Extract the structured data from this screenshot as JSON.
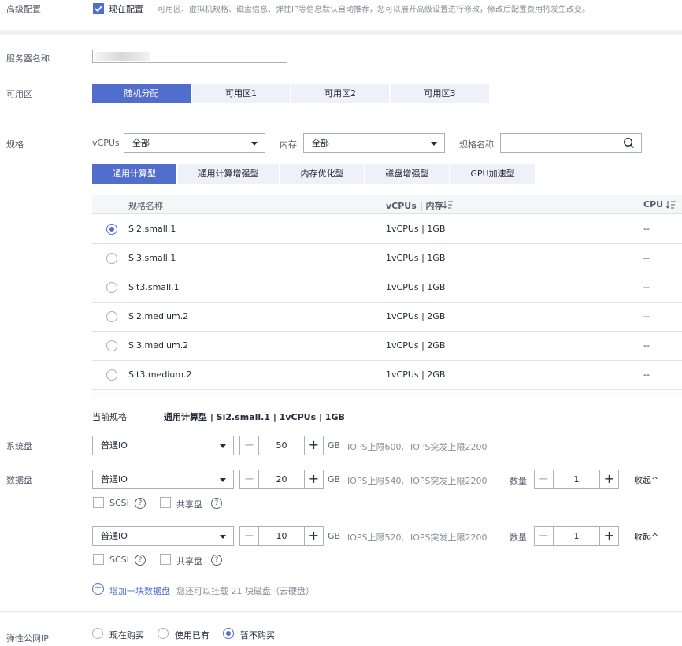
{
  "advanced": {
    "label": "高级配置",
    "checkbox_label": "现在配置",
    "hint": "可用区、虚拟机规格、磁盘信息、弹性IP等信息默认自动推荐，您可以展开高级设置进行修改，修改后配置费用将发生改变。"
  },
  "server_name": {
    "label": "服务器名称",
    "value": ""
  },
  "az": {
    "label": "可用区",
    "options": [
      "随机分配",
      "可用区1",
      "可用区2",
      "可用区3"
    ],
    "selected": 0
  },
  "spec": {
    "label": "规格",
    "vcpus_label": "vCPUs",
    "vcpus_value": "全部",
    "mem_label": "内存",
    "mem_value": "全部",
    "name_label": "规格名称",
    "name_placeholder": "",
    "tabs": [
      "通用计算型",
      "通用计算增强型",
      "内存优化型",
      "磁盘增强型",
      "GPU加速型"
    ],
    "active_tab": 0,
    "columns": [
      "规格名称",
      "vCPUs | 内存",
      "CPU"
    ],
    "sort_icon": "sort-icon",
    "rows": [
      {
        "name": "Si2.small.1",
        "spec": "1vCPUs | 1GB",
        "cpu": "--",
        "selected": true
      },
      {
        "name": "Si3.small.1",
        "spec": "1vCPUs | 1GB",
        "cpu": "--",
        "selected": false
      },
      {
        "name": "Sit3.small.1",
        "spec": "1vCPUs | 1GB",
        "cpu": "--",
        "selected": false
      },
      {
        "name": "Si2.medium.2",
        "spec": "1vCPUs | 2GB",
        "cpu": "--",
        "selected": false
      },
      {
        "name": "Si3.medium.2",
        "spec": "1vCPUs | 2GB",
        "cpu": "--",
        "selected": false
      },
      {
        "name": "Sit3.medium.2",
        "spec": "1vCPUs | 2GB",
        "cpu": "--",
        "selected": false
      }
    ],
    "current_label": "当前规格",
    "current_value": "通用计算型 | Si2.small.1 | 1vCPUs | 1GB"
  },
  "system_disk": {
    "label": "系统盘",
    "type": "普通IO",
    "size": "50",
    "unit": "GB",
    "iops": "IOPS上限600,",
    "iops_burst": "IOPS突发上限2200"
  },
  "data_disk": {
    "label": "数据盘",
    "disks": [
      {
        "type": "普通IO",
        "size": "20",
        "unit": "GB",
        "iops": "IOPS上限540,",
        "iops_burst": "IOPS突发上限2200",
        "qty_label": "数量",
        "qty": "1",
        "collapse": "收起",
        "scsi": "SCSI",
        "shared": "共享盘"
      },
      {
        "type": "普通IO",
        "size": "10",
        "unit": "GB",
        "iops": "IOPS上限520,",
        "iops_burst": "IOPS突发上限2200",
        "qty_label": "数量",
        "qty": "1",
        "collapse": "收起",
        "scsi": "SCSI",
        "shared": "共享盘"
      }
    ],
    "add_label": "增加一块数据盘",
    "add_hint": "您还可以挂载 21 块磁盘（云硬盘）"
  },
  "eip": {
    "label": "弹性公网IP",
    "options": [
      "现在购买",
      "使用已有",
      "暂不购买"
    ],
    "selected": 2
  },
  "colors": {
    "accent": "#526ecc",
    "tab_bg": "#eef1f9",
    "border": "#adb0b8"
  }
}
